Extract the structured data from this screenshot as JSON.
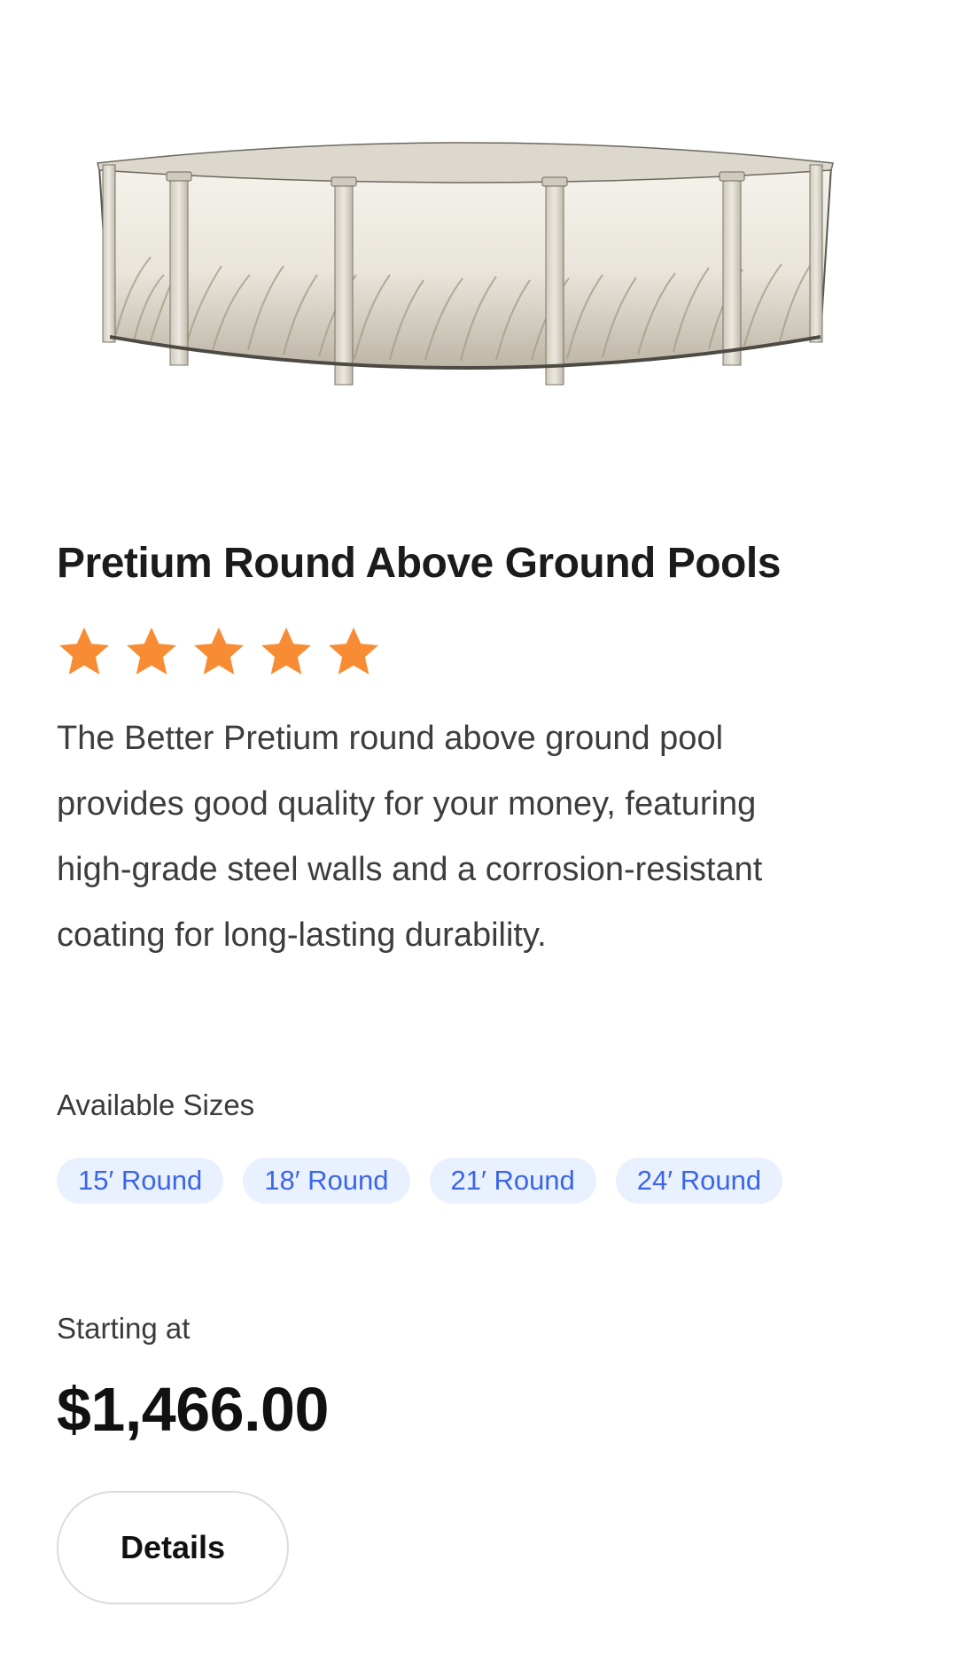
{
  "product": {
    "image_icon": "above-ground-pool-image",
    "title": "Pretium Round Above Ground Pools",
    "rating": 5,
    "rating_max": 5,
    "star_color": "#f78c35",
    "description": "The Better Pretium round above ground pool provides good quality for your money, featuring high-grade steel walls and a corrosion-resistant coating for long-lasting durability.",
    "sizes_label": "Available Sizes",
    "sizes": [
      "15′ Round",
      "18′ Round",
      "21′ Round",
      "24′ Round"
    ],
    "chip_color": "#3a66e6",
    "chip_bg": "#eaf1fe",
    "price_label": "Starting at",
    "price": "$1,466.00",
    "details_label": "Details"
  }
}
